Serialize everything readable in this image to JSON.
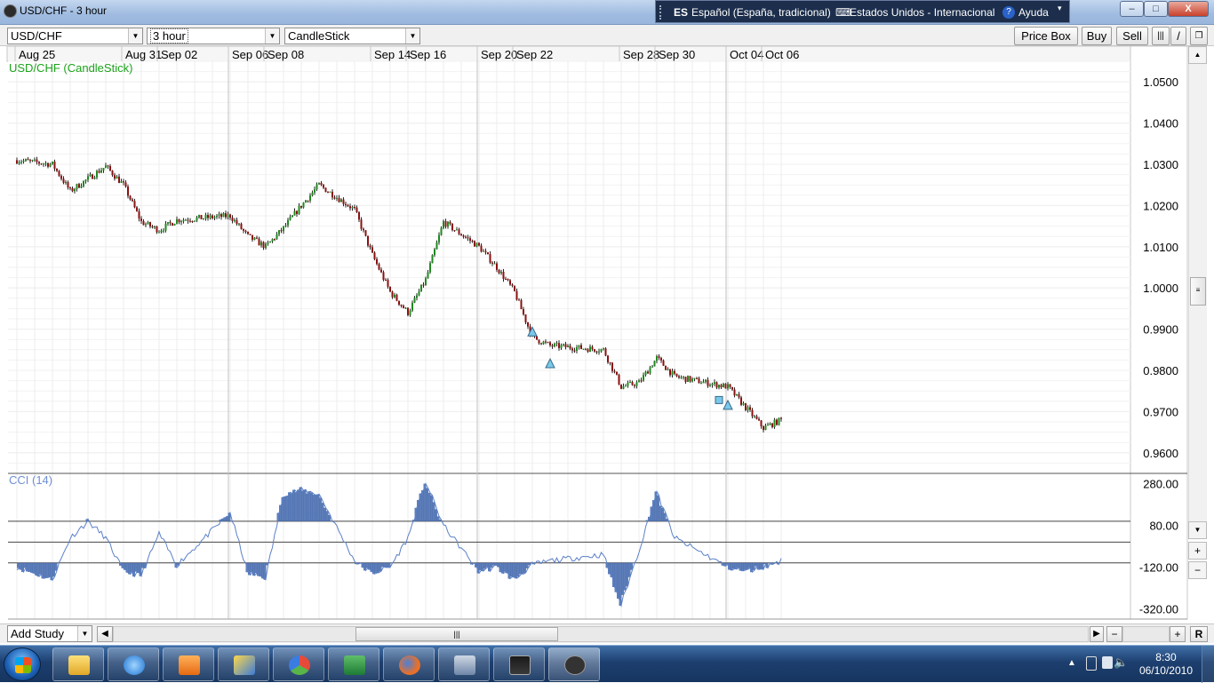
{
  "window": {
    "title": "USD/CHF - 3 hour",
    "language_bar": {
      "lang_code": "ES",
      "language": "Español (España, tradicional)",
      "keyboard": "Estados Unidos - Internacional",
      "help": "Ayuda"
    },
    "buttons": {
      "minimize": "–",
      "maximize": "□",
      "close": "X"
    }
  },
  "toolbar": {
    "symbol": "USD/CHF",
    "interval": "3 hour",
    "chart_type": "CandleStick",
    "price_box": "Price Box",
    "buy": "Buy",
    "sell": "Sell"
  },
  "chart": {
    "main_label": "USD/CHF (CandleStick)",
    "cci_label": "CCI (14)",
    "date_labels": [
      "Aug 25",
      "Aug 31",
      "Sep 02",
      "Sep 06",
      "Sep 08",
      "Sep 14",
      "Sep 16",
      "Sep 20",
      "Sep 22",
      "Sep 28",
      "Sep 30",
      "Oct 04",
      "Oct 06"
    ],
    "price_ticks": [
      "1.0500",
      "1.0400",
      "1.0300",
      "1.0200",
      "1.0100",
      "1.0000",
      "0.9900",
      "0.9800",
      "0.9700",
      "0.9600"
    ],
    "cci_ticks": [
      "280.00",
      "80.00",
      "-120.00",
      "-320.00"
    ]
  },
  "chart_data": [
    {
      "type": "candlestick",
      "title": "USD/CHF (CandleStick)",
      "x_range": [
        "Aug 25",
        "Oct 07"
      ],
      "ylim": [
        0.955,
        1.055
      ],
      "up_color": "#1f8a1f",
      "down_color": "#8b1010",
      "close_path": [
        [
          "Aug 25",
          1.031
        ],
        [
          "Aug 27",
          1.03
        ],
        [
          "Aug 28",
          1.0235
        ],
        [
          "Aug 30",
          1.0295
        ],
        [
          "Aug 31",
          1.025
        ],
        [
          "Sep 01",
          1.016
        ],
        [
          "Sep 02",
          1.014
        ],
        [
          "Sep 03",
          1.0165
        ],
        [
          "Sep 06",
          1.0175
        ],
        [
          "Sep 07",
          1.0125
        ],
        [
          "Sep 08",
          1.01
        ],
        [
          "Sep 09",
          1.0145
        ],
        [
          "Sep 10",
          1.02
        ],
        [
          "Sep 11",
          1.025
        ],
        [
          "Sep 13",
          1.019
        ],
        [
          "Sep 14",
          1.008
        ],
        [
          "Sep 15",
          0.999
        ],
        [
          "Sep 16",
          0.994
        ],
        [
          "Sep 17",
          1.002
        ],
        [
          "Sep 18",
          1.016
        ],
        [
          "Sep 20",
          1.01
        ],
        [
          "Sep 21",
          1.005
        ],
        [
          "Sep 22",
          0.999
        ],
        [
          "Sep 23",
          0.988
        ],
        [
          "Sep 24",
          0.986
        ],
        [
          "Sep 27",
          0.985
        ],
        [
          "Sep 28",
          0.976
        ],
        [
          "Sep 29",
          0.977
        ],
        [
          "Sep 30",
          0.983
        ],
        [
          "Oct 01",
          0.9785
        ],
        [
          "Oct 04",
          0.976
        ],
        [
          "Oct 05",
          0.971
        ],
        [
          "Oct 06",
          0.966
        ],
        [
          "Oct 07",
          0.968
        ]
      ],
      "signals": [
        {
          "date": "Sep 23",
          "price": 0.9892,
          "shape": "triangle"
        },
        {
          "date": "Sep 24",
          "price": 0.9815,
          "shape": "triangle"
        },
        {
          "date": "Oct 04",
          "price": 0.9728,
          "shape": "square"
        },
        {
          "date": "Oct 04",
          "price": 0.9714,
          "shape": "triangle"
        }
      ]
    },
    {
      "type": "area",
      "title": "CCI (14)",
      "ylim": [
        -370,
        330
      ],
      "levels": [
        100,
        0,
        -100
      ],
      "color": "#4a6fb0",
      "points": [
        [
          "Aug 25",
          -120
        ],
        [
          "Aug 26",
          -150
        ],
        [
          "Aug 27",
          -180
        ],
        [
          "Aug 28",
          20
        ],
        [
          "Aug 29",
          100
        ],
        [
          "Aug 30",
          20
        ],
        [
          "Aug 31",
          -140
        ],
        [
          "Sep 01",
          -160
        ],
        [
          "Sep 02",
          40
        ],
        [
          "Sep 03",
          -110
        ],
        [
          "Sep 06",
          140
        ],
        [
          "Sep 07",
          -150
        ],
        [
          "Sep 08",
          -170
        ],
        [
          "Sep 09",
          230
        ],
        [
          "Sep 10",
          250
        ],
        [
          "Sep 11",
          230
        ],
        [
          "Sep 13",
          -90
        ],
        [
          "Sep 14",
          -150
        ],
        [
          "Sep 15",
          -120
        ],
        [
          "Sep 16",
          20
        ],
        [
          "Sep 17",
          290
        ],
        [
          "Sep 18",
          80
        ],
        [
          "Sep 20",
          -140
        ],
        [
          "Sep 21",
          -120
        ],
        [
          "Sep 22",
          -180
        ],
        [
          "Sep 23",
          -110
        ],
        [
          "Sep 24",
          -90
        ],
        [
          "Sep 27",
          -60
        ],
        [
          "Sep 28",
          -300
        ],
        [
          "Sep 29",
          -40
        ],
        [
          "Sep 30",
          240
        ],
        [
          "Oct 01",
          20
        ],
        [
          "Oct 04",
          -120
        ],
        [
          "Oct 05",
          -140
        ],
        [
          "Oct 06",
          -120
        ],
        [
          "Oct 07",
          -90
        ]
      ]
    }
  ],
  "bottom": {
    "add_study": "Add Study",
    "reset": "R"
  },
  "taskbar": {
    "time": "8:30",
    "date": "06/10/2010",
    "apps": [
      "explorer-folder",
      "internet-explorer",
      "media-player",
      "paint-brush",
      "messenger",
      "excel",
      "firefox",
      "network-computer",
      "stock-chart",
      "trading-app"
    ]
  },
  "colors": {
    "candle_up": "#1f8a1f",
    "candle_down": "#8b1010",
    "cci": "#4a6fb0",
    "signal": "#79c8ea",
    "label_green": "#1ba31b"
  }
}
